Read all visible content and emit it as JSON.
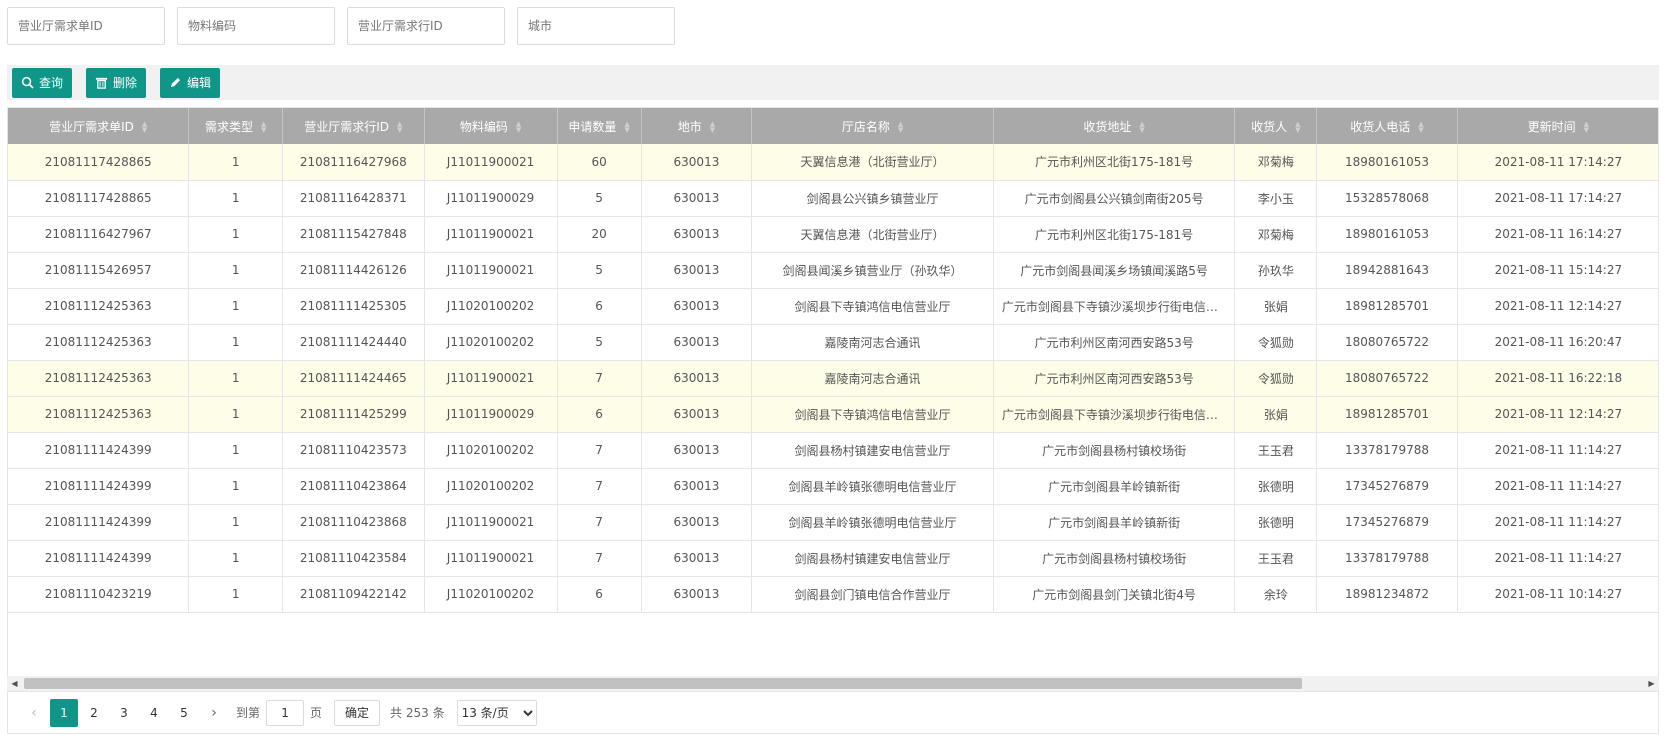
{
  "filters": [
    {
      "placeholder": "营业厅需求单ID",
      "name": "order-id-filter"
    },
    {
      "placeholder": "物料编码",
      "name": "material-code-filter"
    },
    {
      "placeholder": "营业厅需求行ID",
      "name": "line-id-filter"
    },
    {
      "placeholder": "城市",
      "name": "city-filter"
    }
  ],
  "toolbar": {
    "query_label": "查询",
    "delete_label": "删除",
    "edit_label": "编辑",
    "accent": "#0f9688"
  },
  "table": {
    "columns": [
      "营业厅需求单ID",
      "需求类型",
      "营业厅需求行ID",
      "物料编码",
      "申请数量",
      "地市",
      "厅店名称",
      "收货地址",
      "收货人",
      "收货人电话",
      "更新时间"
    ],
    "rows": [
      {
        "hl": true,
        "cells": [
          "21081117428865",
          "1",
          "21081116427968",
          "J11011900021",
          "60",
          "630013",
          "天翼信息港（北街营业厅）",
          "广元市利州区北街175-181号",
          "邓菊梅",
          "18980161053",
          "2021-08-11 17:14:27"
        ]
      },
      {
        "hl": false,
        "cells": [
          "21081117428865",
          "1",
          "21081116428371",
          "J11011900029",
          "5",
          "630013",
          "剑阁县公兴镇乡镇营业厅",
          "广元市剑阁县公兴镇剑南街205号",
          "李小玉",
          "15328578068",
          "2021-08-11 17:14:27"
        ]
      },
      {
        "hl": false,
        "cells": [
          "21081116427967",
          "1",
          "21081115427848",
          "J11011900021",
          "20",
          "630013",
          "天翼信息港（北街营业厅）",
          "广元市利州区北街175-181号",
          "邓菊梅",
          "18980161053",
          "2021-08-11 16:14:27"
        ]
      },
      {
        "hl": false,
        "cells": [
          "21081115426957",
          "1",
          "21081114426126",
          "J11011900021",
          "5",
          "630013",
          "剑阁县闻溪乡镇营业厅（孙玖华）",
          "广元市剑阁县闻溪乡场镇闻溪路5号",
          "孙玖华",
          "18942881643",
          "2021-08-11 15:14:27"
        ]
      },
      {
        "hl": false,
        "cells": [
          "21081112425363",
          "1",
          "21081111425305",
          "J11020100202",
          "6",
          "630013",
          "剑阁县下寺镇鸿信电信营业厅",
          "广元市剑阁县下寺镇沙溪坝步行街电信营业厅",
          "张娟",
          "18981285701",
          "2021-08-11 12:14:27"
        ]
      },
      {
        "hl": false,
        "cells": [
          "21081112425363",
          "1",
          "21081111424440",
          "J11020100202",
          "5",
          "630013",
          "嘉陵南河志合通讯",
          "广元市利州区南河西安路53号",
          "令狐勋",
          "18080765722",
          "2021-08-11 16:20:47"
        ]
      },
      {
        "hl": true,
        "cells": [
          "21081112425363",
          "1",
          "21081111424465",
          "J11011900021",
          "7",
          "630013",
          "嘉陵南河志合通讯",
          "广元市利州区南河西安路53号",
          "令狐勋",
          "18080765722",
          "2021-08-11 16:22:18"
        ]
      },
      {
        "hl": true,
        "cells": [
          "21081112425363",
          "1",
          "21081111425299",
          "J11011900029",
          "6",
          "630013",
          "剑阁县下寺镇鸿信电信营业厅",
          "广元市剑阁县下寺镇沙溪坝步行街电信营业厅",
          "张娟",
          "18981285701",
          "2021-08-11 12:14:27"
        ]
      },
      {
        "hl": false,
        "cells": [
          "21081111424399",
          "1",
          "21081110423573",
          "J11020100202",
          "7",
          "630013",
          "剑阁县杨村镇建安电信营业厅",
          "广元市剑阁县杨村镇校场街",
          "王玉君",
          "13378179788",
          "2021-08-11 11:14:27"
        ]
      },
      {
        "hl": false,
        "cells": [
          "21081111424399",
          "1",
          "21081110423864",
          "J11020100202",
          "7",
          "630013",
          "剑阁县羊岭镇张德明电信营业厅",
          "广元市剑阁县羊岭镇新街",
          "张德明",
          "17345276879",
          "2021-08-11 11:14:27"
        ]
      },
      {
        "hl": false,
        "cells": [
          "21081111424399",
          "1",
          "21081110423868",
          "J11011900021",
          "7",
          "630013",
          "剑阁县羊岭镇张德明电信营业厅",
          "广元市剑阁县羊岭镇新街",
          "张德明",
          "17345276879",
          "2021-08-11 11:14:27"
        ]
      },
      {
        "hl": false,
        "cells": [
          "21081111424399",
          "1",
          "21081110423584",
          "J11011900021",
          "7",
          "630013",
          "剑阁县杨村镇建安电信营业厅",
          "广元市剑阁县杨村镇校场街",
          "王玉君",
          "13378179788",
          "2021-08-11 11:14:27"
        ]
      },
      {
        "hl": false,
        "cells": [
          "21081110423219",
          "1",
          "21081109422142",
          "J11020100202",
          "6",
          "630013",
          "剑阁县剑门镇电信合作营业厅",
          "广元市剑阁县剑门关镇北街4号",
          "余玲",
          "18981234872",
          "2021-08-11 10:14:27"
        ]
      }
    ]
  },
  "pagination": {
    "pages": [
      "1",
      "2",
      "3",
      "4",
      "5"
    ],
    "current": "1",
    "goto_label": "到第",
    "goto_value": "1",
    "page_unit": "页",
    "confirm_label": "确定",
    "total_text": "共 253 条",
    "page_size_selected": "13 条/页",
    "highlight_row_color": "#fdfde8"
  }
}
